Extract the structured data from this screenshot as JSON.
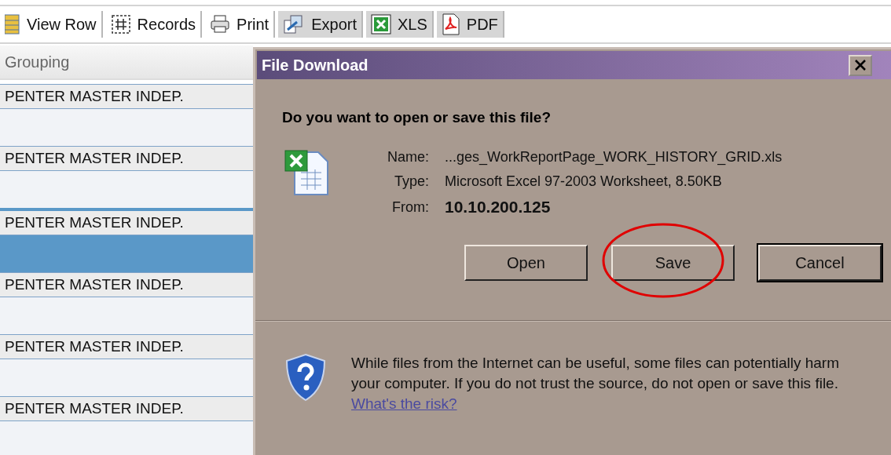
{
  "toolbar": {
    "items": [
      {
        "label": "View Row",
        "highlighted": false
      },
      {
        "label": "Records",
        "highlighted": false
      },
      {
        "label": "Print",
        "highlighted": false
      },
      {
        "label": "Export",
        "highlighted": true
      },
      {
        "label": "XLS",
        "highlighted": true
      },
      {
        "label": "PDF",
        "highlighted": true
      }
    ]
  },
  "grid": {
    "column": "Grouping",
    "rows": [
      {
        "text": "PENTER MASTER INDEP.",
        "selected": false
      },
      {
        "text": "PENTER MASTER INDEP.",
        "selected": false
      },
      {
        "text": "PENTER MASTER INDEP.",
        "selected": true
      },
      {
        "text": "PENTER MASTER INDEP.",
        "selected": false
      },
      {
        "text": "PENTER MASTER INDEP.",
        "selected": false
      },
      {
        "text": "PENTER MASTER INDEP.",
        "selected": false
      }
    ]
  },
  "dialog": {
    "title": "File Download",
    "question": "Do you want to open or save this file?",
    "fields": [
      {
        "label": "Name:",
        "value": "...ges_WorkReportPage_WORK_HISTORY_GRID.xls",
        "kind": "plain"
      },
      {
        "label": "Type:",
        "value": "Microsoft Excel 97-2003 Worksheet, 8.50KB",
        "kind": "plain"
      },
      {
        "label": "From:",
        "value": "10.10.200.125",
        "kind": "strong"
      }
    ],
    "buttons": [
      {
        "label": "Open",
        "default": false,
        "circled": false
      },
      {
        "label": "Save",
        "default": false,
        "circled": true
      },
      {
        "label": "Cancel",
        "default": true,
        "circled": false
      }
    ],
    "warning": {
      "text": "While files from the Internet can be useful, some files can potentially harm your computer. If you do not trust the source, do not open or save this file.",
      "link": "What's the risk?"
    }
  }
}
